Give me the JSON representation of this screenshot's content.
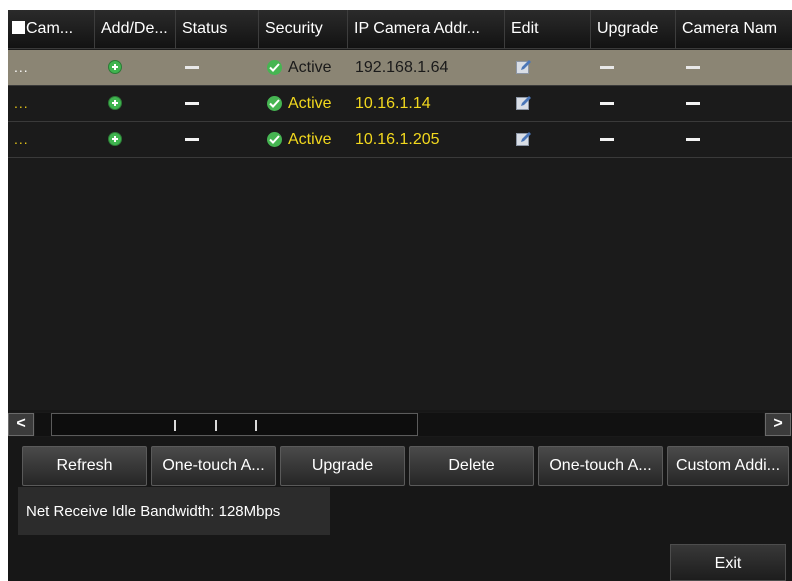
{
  "table": {
    "headers": [
      {
        "label": "Cam..."
      },
      {
        "label": "Add/De..."
      },
      {
        "label": "Status"
      },
      {
        "label": "Security"
      },
      {
        "label": "IP Camera Addr..."
      },
      {
        "label": "Edit"
      },
      {
        "label": "Upgrade"
      },
      {
        "label": "Camera Nam"
      }
    ],
    "rows": [
      {
        "cam": "...",
        "add_icon": "add-circle-icon",
        "status": "dash",
        "security": "Active",
        "ip": "192.168.1.64",
        "edit_icon": "edit-icon",
        "upgrade": "dash",
        "camera_name": "dash",
        "selected": true
      },
      {
        "cam": "...",
        "add_icon": "add-circle-icon",
        "status": "dash",
        "security": "Active",
        "ip": "10.16.1.14",
        "edit_icon": "edit-icon",
        "upgrade": "dash",
        "camera_name": "dash",
        "selected": false
      },
      {
        "cam": "...",
        "add_icon": "add-circle-icon",
        "status": "dash",
        "security": "Active",
        "ip": "10.16.1.205",
        "edit_icon": "edit-icon",
        "upgrade": "dash",
        "camera_name": "dash",
        "selected": false
      }
    ]
  },
  "scrollbar": {
    "left_arrow": "<",
    "right_arrow": ">"
  },
  "buttons": {
    "refresh": "Refresh",
    "one_touch_activate": "One-touch A...",
    "upgrade": "Upgrade",
    "delete": "Delete",
    "one_touch_adding": "One-touch A...",
    "custom_adding": "Custom Addi..."
  },
  "bandwidth_text": "Net Receive Idle Bandwidth: 128Mbps",
  "exit_label": "Exit",
  "colors": {
    "background": "#171717",
    "selected_row": "#8b8574",
    "ip_text": "#f2d81e",
    "status_ok": "#46b552"
  }
}
